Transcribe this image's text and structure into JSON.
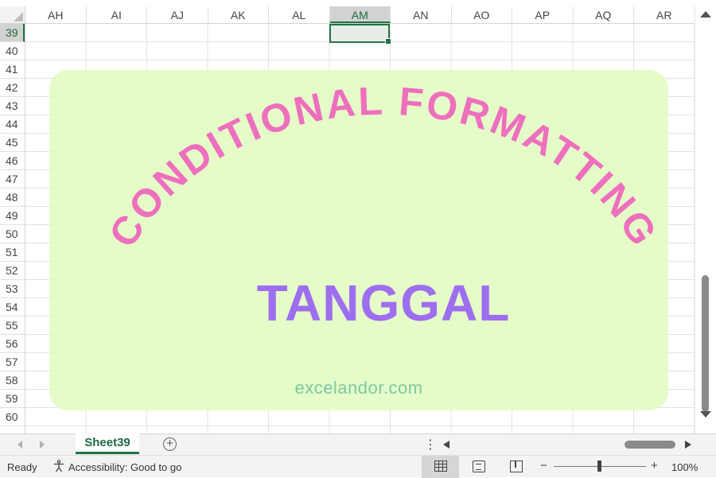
{
  "columns": [
    "AH",
    "AI",
    "AJ",
    "AK",
    "AL",
    "AM",
    "AN",
    "AO",
    "AP",
    "AQ",
    "AR"
  ],
  "selected_column": "AM",
  "rows": [
    "39",
    "40",
    "41",
    "42",
    "43",
    "44",
    "45",
    "46",
    "47",
    "48",
    "49",
    "50",
    "51",
    "52",
    "53",
    "54",
    "55",
    "56",
    "57",
    "58",
    "59",
    "60"
  ],
  "selected_row": "39",
  "banner": {
    "arc_title": "CONDITIONAL FORMATTING",
    "subtitle": "TANGGAL",
    "brand": "excelandor.com",
    "colors": {
      "arc_title": "#ee6fbd",
      "subtitle": "#9e6ef0",
      "brand": "#7cc9a3",
      "background": "#e6fbc8"
    }
  },
  "sheet_tabs": [
    {
      "label": "Sheet39",
      "active": true
    }
  ],
  "status": {
    "ready": "Ready",
    "accessibility": "Accessibility: Good to go",
    "zoom": "100%"
  },
  "icons": {
    "add_sheet": "+",
    "more": "⋮",
    "zoom_minus": "−",
    "zoom_plus": "+"
  },
  "colors": {
    "accent": "#217346"
  }
}
